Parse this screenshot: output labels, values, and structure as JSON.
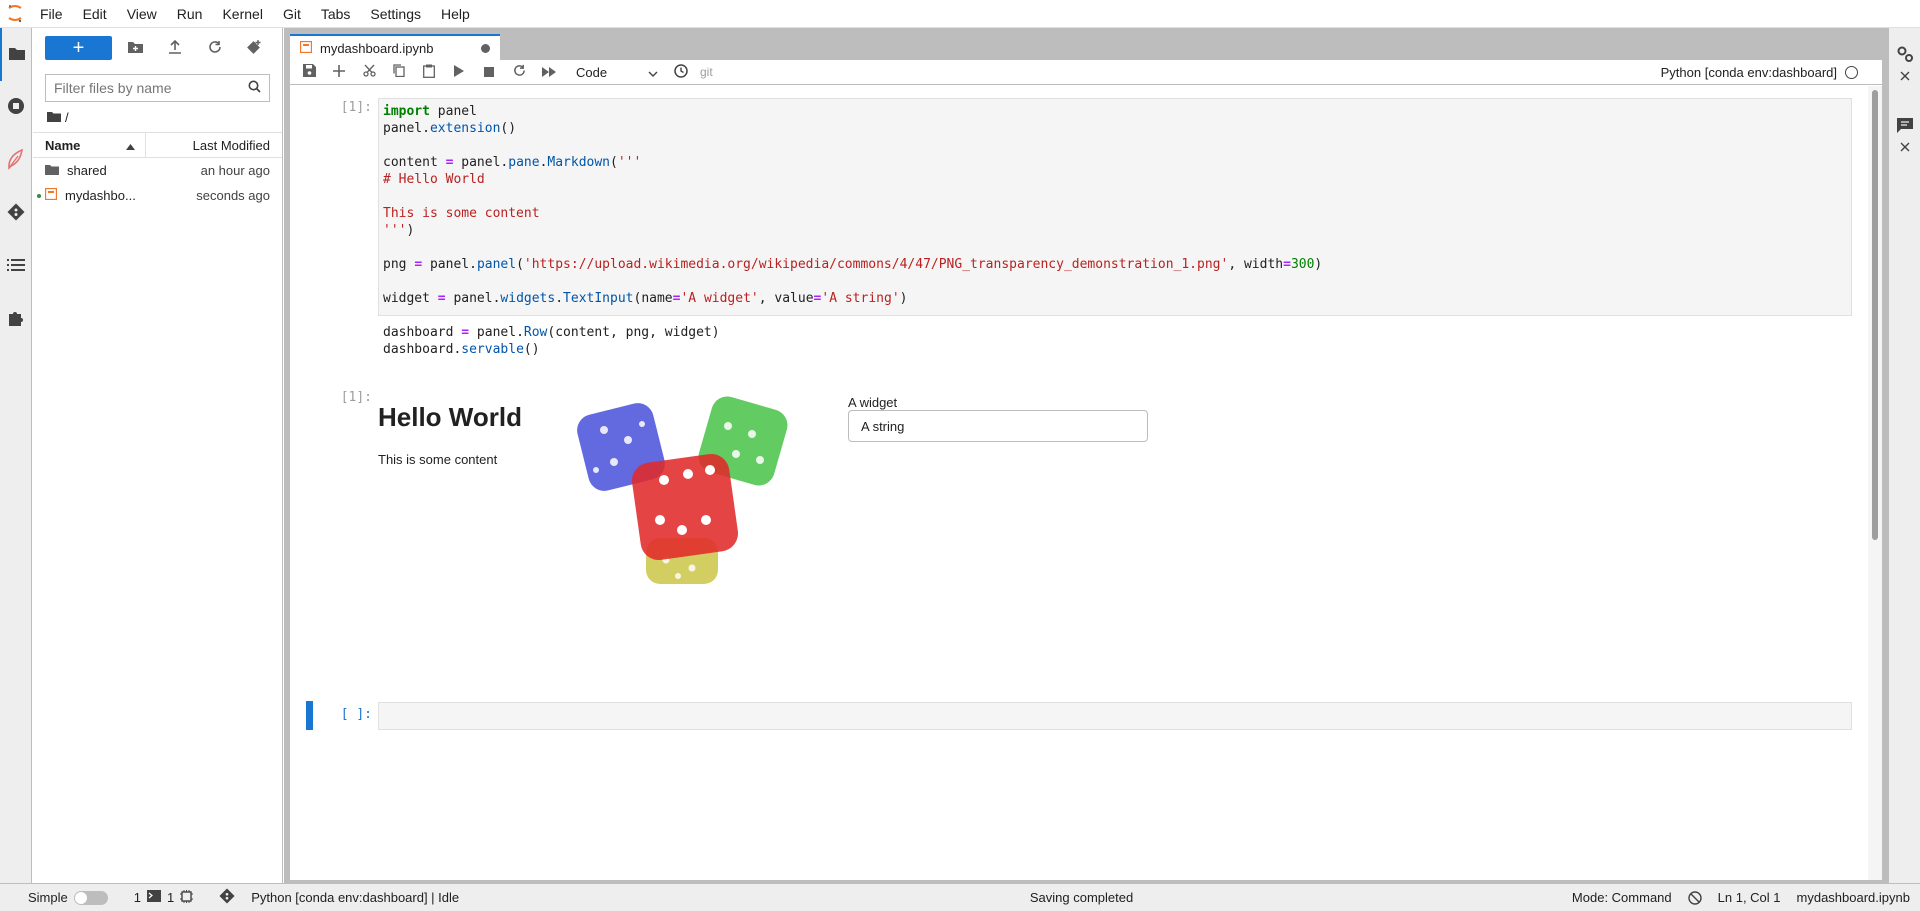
{
  "menubar": {
    "items": [
      "File",
      "Edit",
      "View",
      "Run",
      "Kernel",
      "Git",
      "Tabs",
      "Settings",
      "Help"
    ]
  },
  "filebrowser": {
    "new_label": "+",
    "search_placeholder": "Filter files by name",
    "breadcrumb": "/",
    "columns": {
      "name": "Name",
      "modified": "Last Modified"
    },
    "files": [
      {
        "name": "shared",
        "modified": "an hour ago",
        "type": "folder"
      },
      {
        "name": "mydashbo...",
        "modified": "seconds ago",
        "type": "notebook"
      }
    ]
  },
  "notebook": {
    "tab_title": "mydashboard.ipynb",
    "cell_type": "Code",
    "git_label": "git",
    "kernel": "Python [conda env:dashboard]",
    "cells": [
      {
        "prompt": "[1]:"
      },
      {
        "prompt": "[1]:"
      },
      {
        "prompt": "[ ]:"
      }
    ],
    "code": {
      "l1a": "import",
      "l1b": " panel",
      "l2a": "panel.",
      "l2b": "extension",
      "l2c": "()",
      "l4a": "content ",
      "l4b": "=",
      "l4c": " panel.",
      "l4d": "pane",
      "l4e": ".",
      "l4f": "Markdown",
      "l4g": "(",
      "l4h": "'''",
      "l5": "# Hello World",
      "l7": "This is some content",
      "l8a": "'''",
      "l8b": ")",
      "l10a": "png ",
      "l10b": "=",
      "l10c": " panel.",
      "l10d": "panel",
      "l10e": "(",
      "l10f": "'https://upload.wikimedia.org/wikipedia/commons/4/47/PNG_transparency_demonstration_1.png'",
      "l10g": ", width",
      "l10h": "=",
      "l10i": "300",
      "l10j": ")",
      "l12a": "widget ",
      "l12b": "=",
      "l12c": " panel.",
      "l12d": "widgets",
      "l12e": ".",
      "l12f": "TextInput",
      "l12g": "(name",
      "l12h": "=",
      "l12i": "'A widget'",
      "l12j": ", value",
      "l12k": "=",
      "l12l": "'A string'",
      "l12m": ")",
      "l14a": "dashboard ",
      "l14b": "=",
      "l14c": " panel.",
      "l14d": "Row",
      "l14e": "(content, png, widget)",
      "l15a": "dashboard.",
      "l15b": "servable",
      "l15c": "()"
    },
    "output": {
      "title": "Hello World",
      "text": "This is some content",
      "widget_label": "A widget",
      "widget_value": "A string"
    }
  },
  "statusbar": {
    "mode_label": "Simple",
    "terminals": "1",
    "kernels": "1",
    "kernel_status": "Python [conda env:dashboard] | Idle",
    "message": "Saving completed",
    "mode": "Mode: Command",
    "position": "Ln 1, Col 1",
    "filename": "mydashboard.ipynb"
  },
  "colors": {
    "accent": "#1976d2",
    "keyword": "#008000",
    "string": "#ba2121",
    "attribute": "#0055aa",
    "operator": "#aa22ff"
  }
}
